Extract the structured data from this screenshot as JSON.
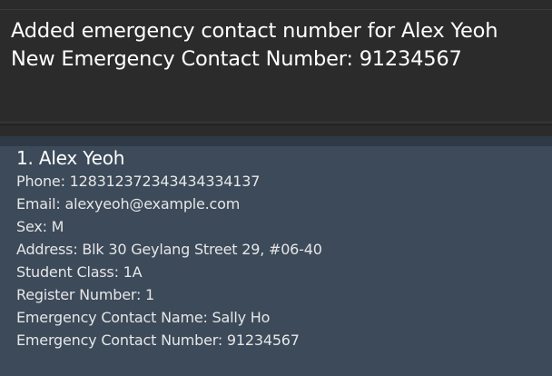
{
  "result_display": {
    "line1": "Added emergency contact number for Alex Yeoh",
    "line2": "New Emergency Contact Number: 91234567"
  },
  "person_list": {
    "cards": [
      {
        "index_name": "1. Alex Yeoh",
        "phone": "Phone: 128312372343434334137",
        "email": "Email: alexyeoh@example.com",
        "sex": "Sex: M",
        "address": "Address: Blk 30 Geylang Street 29, #06-40",
        "student_class": "Student Class: 1A",
        "register_number": "Register Number: 1",
        "emergency_contact_name": "Emergency Contact Name: Sally Ho",
        "emergency_contact_number": "Emergency Contact Number: 91234567"
      }
    ]
  },
  "colors": {
    "app_background": "#2b2b2b",
    "list_background": "#3c4a5a",
    "text_primary": "#ffffff"
  }
}
